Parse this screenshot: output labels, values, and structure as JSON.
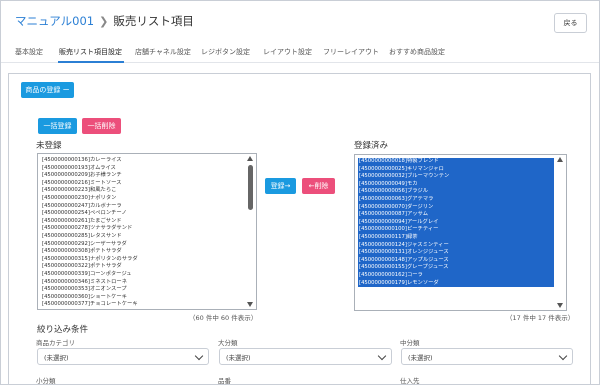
{
  "breadcrumb": {
    "parent": "マニュアル001",
    "current": "販売リスト項目"
  },
  "back_label": "戻る",
  "tabs": [
    {
      "label": "基本設定"
    },
    {
      "label": "販売リスト項目設定",
      "active": true
    },
    {
      "label": "店舗チャネル設定"
    },
    {
      "label": "レジボタン設定"
    },
    {
      "label": "レイアウト設定"
    },
    {
      "label": "フリーレイアウト"
    },
    {
      "label": "おすすめ商品設定"
    }
  ],
  "register_product_label": "商品の登録 ー",
  "bulk_register_label": "一括登録",
  "bulk_delete_label": "一括削除",
  "unregistered": {
    "title": "未登録",
    "items": [
      "[4500000000136]カレーライス",
      "[4500000000193]オムライス",
      "[4500000000209]お子様ランチ",
      "[4500000000216]ミートソース",
      "[4500000000223]和風たらこ",
      "[4500000000230]ナポリタン",
      "[4500000000247]カルボナーラ",
      "[4500000000254]ペペロンチーノ",
      "[4500000000261]たまごサンド",
      "[4500000000278]ツナサラダサンド",
      "[4500000000285]レタスサンド",
      "[4500000000292]シーザーサラダ",
      "[4500000000308]ポテトサラダ",
      "[4500000000315]ナポリタンのサラダ",
      "[4500000000322]ポテトサラダ",
      "[4500000000339]コーンポタージュ",
      "[4500000000346]ミネストローネ",
      "[4500000000353]オニオンスープ",
      "[4500000000360]ショートケーキ",
      "[4500000000377]チョコレートケーキ"
    ],
    "count_label": "（60 件中 60 件表示）"
  },
  "move_buttons": {
    "register": "登録→",
    "remove": "←削除"
  },
  "registered": {
    "title": "登録済み",
    "items": [
      "[4500000000018]特製ブレンド",
      "[4500000000025]キリマンジャロ",
      "[4500000000032]ブルーマウンテン",
      "[4500000000049]モカ",
      "[4500000000056]ブラジル",
      "[4500000000063]グアテマラ",
      "[4500000000070]ダージリン",
      "[4500000000087]アッサム",
      "[4500000000094]アールグレイ",
      "[4500000000100]ピーチティー",
      "[4500000000117]緑茶",
      "[4500000000124]ジャスミンティー",
      "[4500000000131]オレンジジュース",
      "[4500000000148]アップルジュース",
      "[4500000000155]グレープジュース",
      "[4500000000162]コーラ",
      "[4500000000179]レモンソーダ"
    ],
    "count_label": "（17 件中 17 件表示）"
  },
  "filter": {
    "title": "絞り込み条件",
    "fields": [
      {
        "label": "商品カテゴリ",
        "value": "(未選択)"
      },
      {
        "label": "大分類",
        "value": "(未選択)"
      },
      {
        "label": "中分類",
        "value": "(未選択)"
      }
    ],
    "next_labels": [
      "小分類",
      "品番",
      "仕入先"
    ]
  },
  "colors": {
    "accent": "#1a9ae0",
    "danger": "#ec4f7b",
    "selection": "#1f66c8",
    "link": "#2b7fd4"
  }
}
